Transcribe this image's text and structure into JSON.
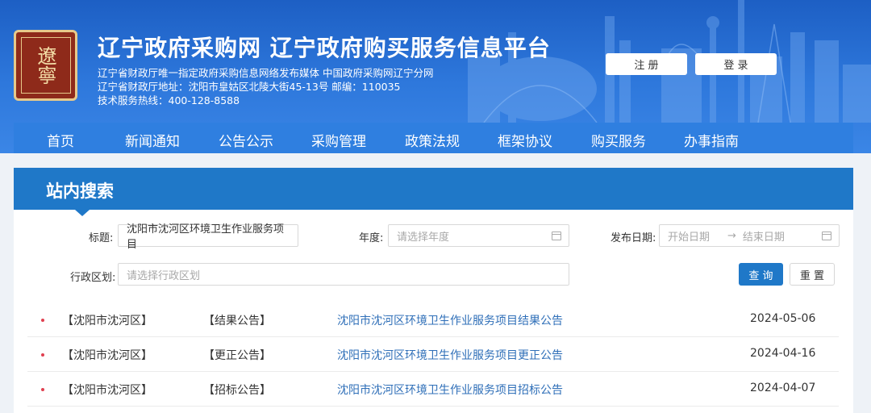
{
  "header": {
    "logo_text": "遼寧",
    "site_title": "辽宁政府采购网 辽宁政府购买服务信息平台",
    "info_line1": "辽宁省财政厅唯一指定政府采购信息网络发布媒体 中国政府采购网辽宁分网",
    "info_line2": "辽宁省财政厅地址：沈阳市皇姑区北陵大街45-13号 邮编：110035",
    "info_line3": "技术服务热线：400-128-8588",
    "register_label": "注 册",
    "login_label": "登 录"
  },
  "nav": {
    "items": [
      {
        "label": "首页"
      },
      {
        "label": "新闻通知"
      },
      {
        "label": "公告公示"
      },
      {
        "label": "采购管理"
      },
      {
        "label": "政策法规"
      },
      {
        "label": "框架协议"
      },
      {
        "label": "购买服务"
      },
      {
        "label": "办事指南"
      }
    ]
  },
  "search": {
    "panel_title": "站内搜索",
    "title_label": "标题:",
    "title_value": "沈阳市沈河区环境卫生作业服务项目",
    "year_label": "年度:",
    "year_placeholder": "请选择年度",
    "date_label": "发布日期:",
    "start_placeholder": "开始日期",
    "date_separator": "→",
    "end_placeholder": "结束日期",
    "region_label": "行政区划:",
    "region_placeholder": "请选择行政区划",
    "query_label": "查 询",
    "reset_label": "重 置"
  },
  "results": [
    {
      "region": "【沈阳市沈河区】",
      "type": "【结果公告】",
      "title": "沈阳市沈河区环境卫生作业服务项目结果公告",
      "date": "2024-05-06"
    },
    {
      "region": "【沈阳市沈河区】",
      "type": "【更正公告】",
      "title": "沈阳市沈河区环境卫生作业服务项目更正公告",
      "date": "2024-04-16"
    },
    {
      "region": "【沈阳市沈河区】",
      "type": "【招标公告】",
      "title": "沈阳市沈河区环境卫生作业服务项目招标公告",
      "date": "2024-04-07"
    }
  ],
  "colors": {
    "header_blue": "#2e78dc",
    "panel_blue": "#1f78c8",
    "link_blue": "#2f6fb8",
    "logo_red": "#8e2a1a",
    "bullet_red": "#e04050"
  }
}
